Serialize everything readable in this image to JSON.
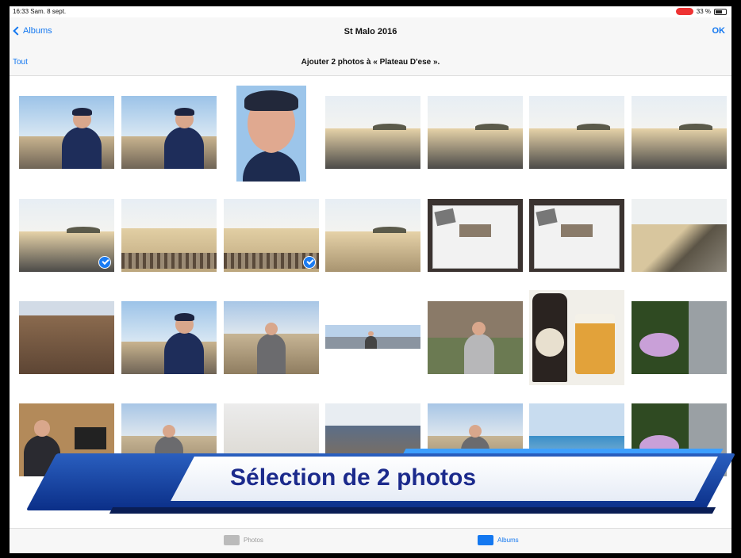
{
  "status_bar": {
    "time": "16:33 Sam. 8 sept.",
    "battery": "33 %"
  },
  "nav": {
    "back_label": "Albums",
    "title": "St Malo 2016",
    "done_label": "OK"
  },
  "subbar": {
    "select_all_label": "Tout",
    "prompt": "Ajouter 2 photos à « Plateau D'ese »."
  },
  "banner": {
    "text": "Sélection de 2 photos"
  },
  "tabs": [
    {
      "label": "Photos",
      "selected": false
    },
    {
      "label": "Albums",
      "selected": true
    }
  ],
  "photos": [
    {
      "kind": "selfie"
    },
    {
      "kind": "selfie"
    },
    {
      "kind": "portrait"
    },
    {
      "kind": "beach"
    },
    {
      "kind": "beach"
    },
    {
      "kind": "beach"
    },
    {
      "kind": "beach"
    },
    {
      "kind": "beach",
      "selected": true
    },
    {
      "kind": "fence"
    },
    {
      "kind": "fence",
      "selected": true
    },
    {
      "kind": "coast"
    },
    {
      "kind": "poster"
    },
    {
      "kind": "poster"
    },
    {
      "kind": "rocks"
    },
    {
      "kind": "castle"
    },
    {
      "kind": "selfie"
    },
    {
      "kind": "person"
    },
    {
      "kind": "pano"
    },
    {
      "kind": "terrace"
    },
    {
      "kind": "beer"
    },
    {
      "kind": "garden"
    },
    {
      "kind": "table"
    },
    {
      "kind": "person"
    },
    {
      "kind": "haze"
    },
    {
      "kind": "fort"
    },
    {
      "kind": "person"
    },
    {
      "kind": "sea"
    },
    {
      "kind": "garden"
    }
  ],
  "colors": {
    "accent": "#1478f0",
    "banner_blue": "#1b2a8c",
    "check_blue": "#1a7bf2"
  }
}
